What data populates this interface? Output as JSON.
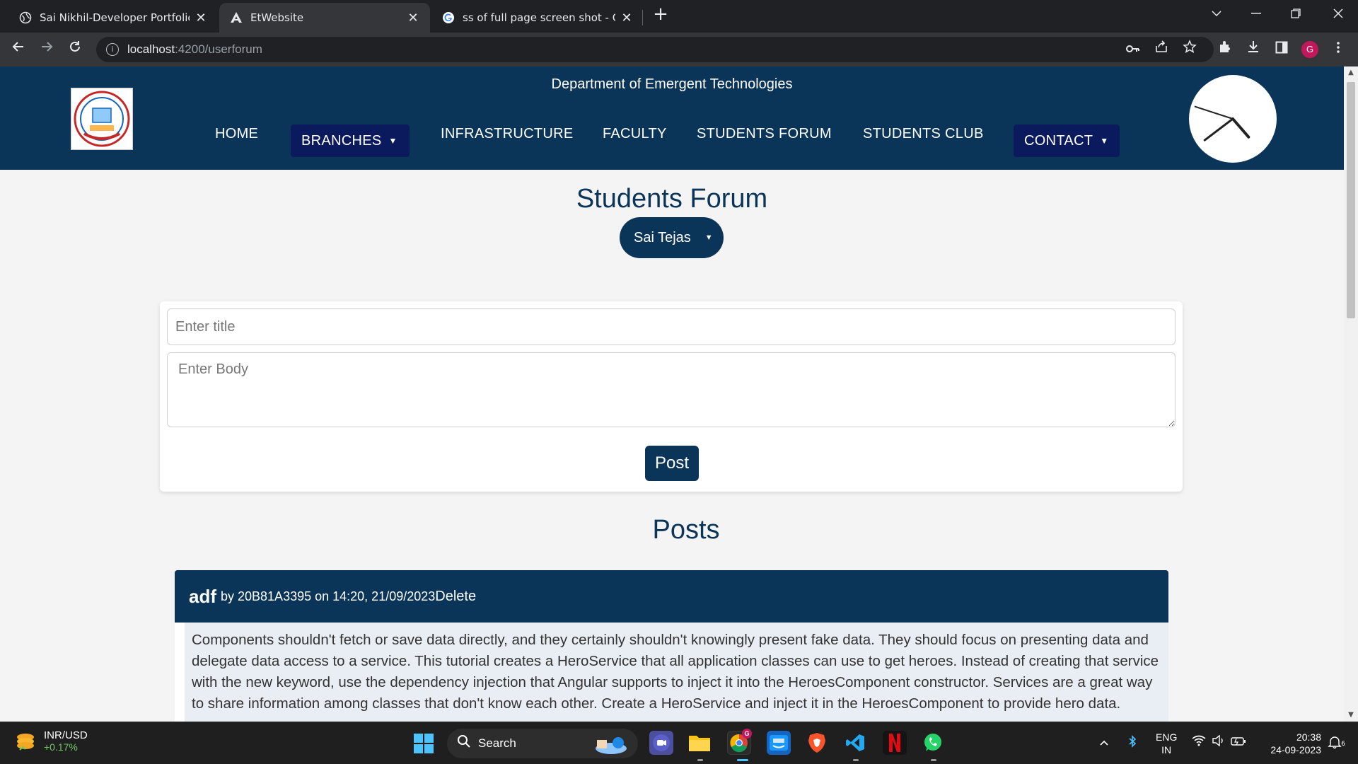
{
  "browser": {
    "tabs": [
      {
        "title": "Sai Nikhil-Developer Portfolio",
        "close": "✕"
      },
      {
        "title": "EtWebsite",
        "close": "✕"
      },
      {
        "title": "ss of full page screen shot - Goo",
        "close": "✕"
      }
    ],
    "new_tab": "+",
    "url_host": "localhost",
    "url_path": ":4200/userforum",
    "profile_initial": "G"
  },
  "site": {
    "department": "Department of Emergent Technologies",
    "nav": {
      "home": "HOME",
      "branches": "BRANCHES",
      "infrastructure": "INFRASTRUCTURE",
      "faculty": "FACULTY",
      "students_forum": "STUDENTS FORUM",
      "students_club": "STUDENTS CLUB",
      "contact": "CONTACT"
    },
    "clock": {
      "hour": 4,
      "minute": 38,
      "second": 48
    }
  },
  "forum": {
    "title": "Students Forum",
    "user": "Sai Tejas",
    "form": {
      "title_placeholder": "Enter title",
      "body_placeholder": "Enter Body",
      "post_label": "Post"
    },
    "posts_heading": "Posts",
    "posts": [
      {
        "title": "adf",
        "meta": "by 20B81A3395 on 14:20, 21/09/2023",
        "delete_label": "Delete",
        "body": "Components shouldn't fetch or save data directly, and they certainly shouldn't knowingly present fake data. They should focus on presenting data and delegate data access to a service. This tutorial creates a HeroService that all application classes can use to get heroes. Instead of creating that service with the new keyword, use the dependency injection that Angular supports to inject it into the HeroesComponent constructor. Services are a great way to share information among classes that don't know each other. Create a HeroService and inject it in the HeroesComponent to provide hero data."
      }
    ]
  },
  "taskbar": {
    "weather_title": "INR/USD",
    "weather_value": "+0.17%",
    "search_label": "Search",
    "lang_1": "ENG",
    "lang_2": "IN",
    "time": "20:38",
    "date": "24-09-2023",
    "notif_badge": "6",
    "chrome_badge": "G"
  },
  "colors": {
    "brand_navy": "#0b3558",
    "dropdown_navy": "#0a1a5c",
    "post_body_bg": "#e9eef4"
  }
}
